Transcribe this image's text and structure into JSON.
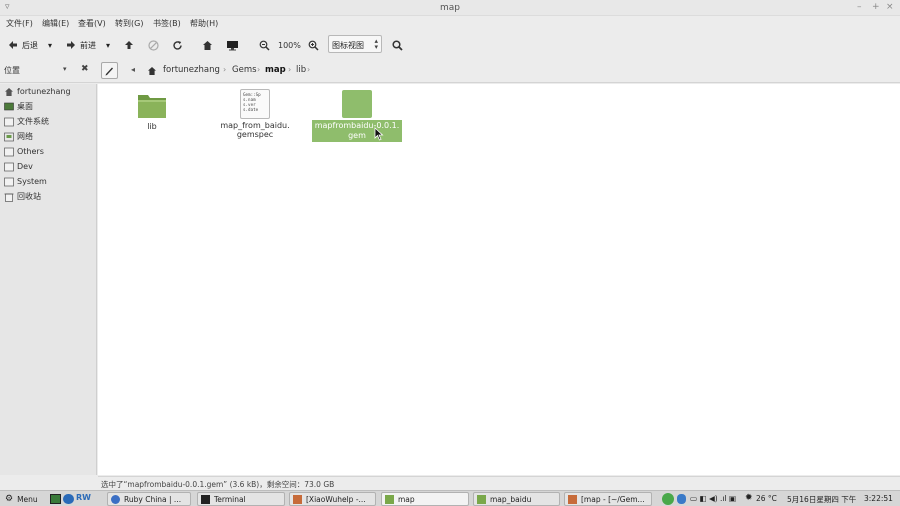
{
  "window": {
    "title": "map"
  },
  "menu": [
    "文件(F)",
    "编辑(E)",
    "查看(V)",
    "转到(G)",
    "书签(B)",
    "帮助(H)"
  ],
  "toolbar": {
    "back_label": "后退",
    "forward_label": "前进",
    "zoom_value": "100%",
    "view_mode": "图标视图"
  },
  "location": {
    "combo_label": "位置",
    "crumbs": [
      "fortunezhang",
      "Gems",
      "map",
      "lib"
    ]
  },
  "sidebar": {
    "items": [
      {
        "label": "fortunezhang",
        "icon": "home-icon"
      },
      {
        "label": "桌面",
        "icon": "desktop-icon"
      },
      {
        "label": "文件系统",
        "icon": "drive-icon"
      },
      {
        "label": "网络",
        "icon": "network-icon"
      },
      {
        "label": "Others",
        "icon": "drive-icon"
      },
      {
        "label": "Dev",
        "icon": "drive-icon"
      },
      {
        "label": "System",
        "icon": "drive-icon"
      },
      {
        "label": "回收站",
        "icon": "trash-icon"
      }
    ]
  },
  "files": [
    {
      "name": "lib",
      "type": "folder"
    },
    {
      "name_line1": "map_from_baidu.",
      "name_line2": "gemspec",
      "type": "text-file",
      "preview": [
        "Gem::Sp",
        "s.nam",
        "s.ver",
        "s.date"
      ]
    },
    {
      "name_line1": "mapfrombaidu-0.0.1.",
      "name_line2": "gem",
      "type": "gem-file",
      "selected": true
    }
  ],
  "status": {
    "text": "选中了“mapfrombaidu-0.0.1.gem” (3.6 kB)，剩余空间：73.0 GB"
  },
  "taskbar": {
    "menu_label": "Menu",
    "tasks": [
      "Ruby China | ...",
      "Terminal",
      "[XiaoWuhelp -...",
      "map",
      "map_baidu",
      "[map - [~/Gem..."
    ],
    "temperature": "26 °C",
    "date": "5月16日星期四 下午",
    "time": "3:22:51"
  },
  "colors": {
    "folder_green": "#8ab35a",
    "selection_green": "#8fbd6c",
    "background": "#ececec"
  }
}
